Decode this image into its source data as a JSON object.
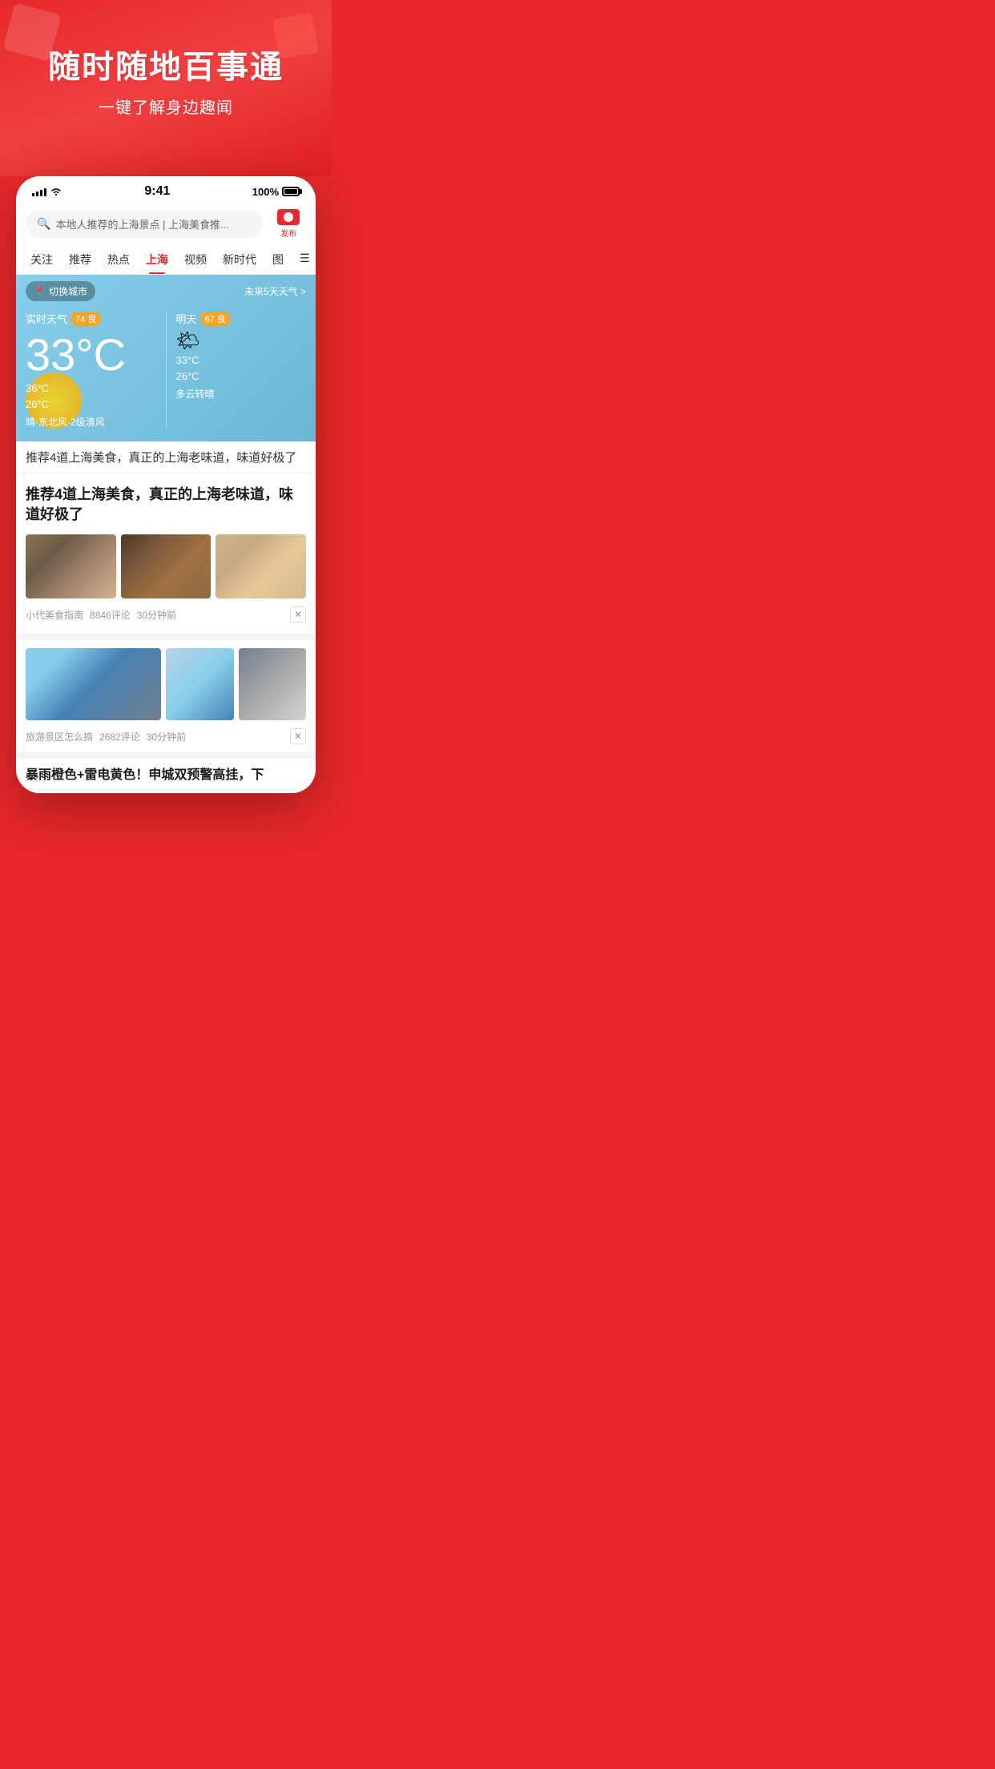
{
  "hero": {
    "title": "随时随地百事通",
    "subtitle": "一键了解身边趣闻"
  },
  "status_bar": {
    "time": "9:41",
    "battery_percent": "100%"
  },
  "search": {
    "placeholder": "本地人推荐的上海景点 | 上海美食推...",
    "camera_label": "发布"
  },
  "nav_tabs": [
    {
      "label": "关注",
      "active": false
    },
    {
      "label": "推荐",
      "active": false
    },
    {
      "label": "热点",
      "active": false
    },
    {
      "label": "上海",
      "active": true
    },
    {
      "label": "视频",
      "active": false
    },
    {
      "label": "新时代",
      "active": false
    },
    {
      "label": "图",
      "active": false
    }
  ],
  "weather": {
    "city_switch": "切换城市",
    "future_link": "未来5天天气 >",
    "today": {
      "label": "实时天气",
      "quality_score": "74",
      "quality_text": "良",
      "temp_main": "33°C",
      "temp_high": "36°C",
      "temp_low": "26°C",
      "description": "晴·东北风·2级清风"
    },
    "tomorrow": {
      "label": "明天",
      "quality_score": "67",
      "quality_text": "良",
      "temp_high": "33°C",
      "temp_low": "26°C",
      "description": "多云转晴"
    }
  },
  "articles": [
    {
      "id": "behind",
      "title": "推荐4道上海美食，真正的上海老味道，味道好极了"
    },
    {
      "id": "main",
      "title": "推荐4道上海美食，真正的上海老味道，味道好极了",
      "source": "小代美食指南",
      "comments": "8846评论",
      "time": "30分钟前"
    },
    {
      "id": "second",
      "source": "旅游景区怎么搞",
      "comments": "2682评论",
      "time": "30分钟前"
    },
    {
      "id": "third",
      "title": "暴雨橙色+雷电黄色！申城双预警高挂，下"
    }
  ]
}
